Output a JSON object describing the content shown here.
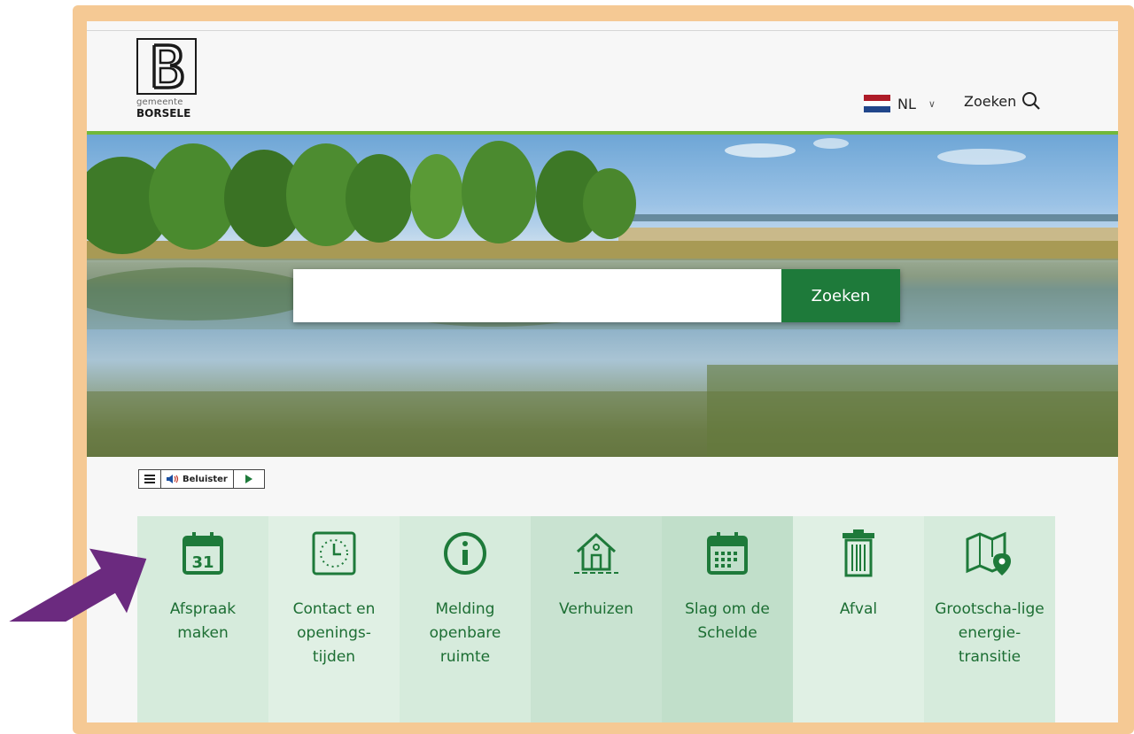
{
  "header": {
    "logo_sub": "gemeente",
    "logo_main": "BORSELE",
    "language": "NL",
    "search_link": "Zoeken"
  },
  "search": {
    "placeholder": "",
    "button_label": "Zoeken"
  },
  "readspeaker": {
    "listen_label": "Beluister"
  },
  "tiles": [
    {
      "label": "Afspraak maken",
      "icon": "calendar-31-icon",
      "bg": "#d6ebdc"
    },
    {
      "label": "Contact en openings-tijden",
      "icon": "clock-icon",
      "bg": "#e0f0e4"
    },
    {
      "label": "Melding openbare ruimte",
      "icon": "info-icon",
      "bg": "#d6ebdc"
    },
    {
      "label": "Verhuizen",
      "icon": "house-icon",
      "bg": "#c9e3d1"
    },
    {
      "label": "Slag om de Schelde",
      "icon": "calendar-grid-icon",
      "bg": "#c1dfca"
    },
    {
      "label": "Afval",
      "icon": "trash-icon",
      "bg": "#e0f0e4"
    },
    {
      "label": "Grootscha-lige energie-transitie",
      "icon": "map-pin-icon",
      "bg": "#d6ebdc"
    }
  ],
  "colors": {
    "brand_green": "#1e7a3a",
    "accent_line": "#71b83a",
    "annotation_frame": "#f5c994",
    "annotation_arrow": "#6b2a7f"
  }
}
